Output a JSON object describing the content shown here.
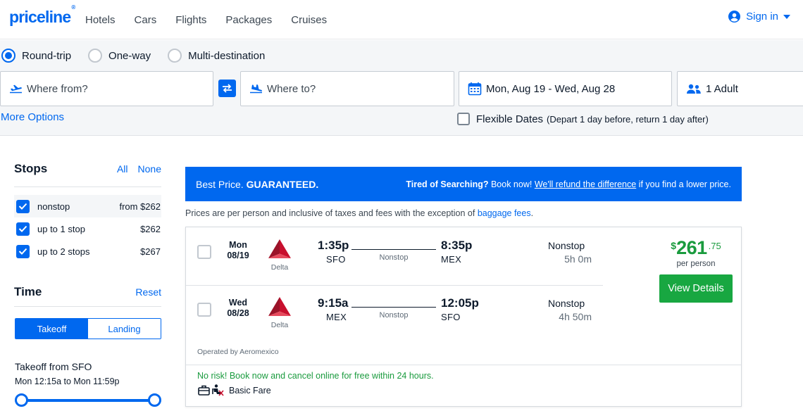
{
  "header": {
    "logo": "priceline",
    "logo_mark": "®",
    "nav": [
      "Hotels",
      "Cars",
      "Flights",
      "Packages",
      "Cruises"
    ],
    "sign_in": "Sign in"
  },
  "search": {
    "trip_types": [
      {
        "label": "Round-trip",
        "selected": true
      },
      {
        "label": "One-way",
        "selected": false
      },
      {
        "label": "Multi-destination",
        "selected": false
      }
    ],
    "from_placeholder": "Where from?",
    "to_placeholder": "Where to?",
    "dates": "Mon, Aug 19 - Wed, Aug 28",
    "passengers": "1 Adult",
    "more_options": "More Options",
    "flexible_label": "Flexible Dates",
    "flexible_note": "(Depart 1 day before, return 1 day after)"
  },
  "filters": {
    "stops_title": "Stops",
    "all": "All",
    "none": "None",
    "stops": [
      {
        "label": "nonstop",
        "price": "from $262",
        "checked": true
      },
      {
        "label": "up to 1 stop",
        "price": "$262",
        "checked": true
      },
      {
        "label": "up to 2 stops",
        "price": "$267",
        "checked": true
      }
    ],
    "time_title": "Time",
    "reset": "Reset",
    "takeoff_tab": "Takeoff",
    "landing_tab": "Landing",
    "takeoff_from": "Takeoff from SFO",
    "takeoff_range": "Mon 12:15a to Mon 11:59p"
  },
  "banner": {
    "best": "Best Price.",
    "guaranteed": "GUARANTEED.",
    "tired": "Tired of Searching?",
    "book_now": " Book now! ",
    "refund_link": "We'll refund the difference",
    "lower": " if you find a lower price."
  },
  "disclaimer": {
    "text": "Prices are per person and inclusive of taxes and fees with the exception of ",
    "link": "baggage fees",
    "end": "."
  },
  "result": {
    "legs": [
      {
        "day": "Mon",
        "date": "08/19",
        "airline": "Delta",
        "dep_time": "1:35p",
        "dep_code": "SFO",
        "arr_time": "8:35p",
        "arr_code": "MEX",
        "route": "Nonstop",
        "stops": "Nonstop",
        "duration": "5h 0m"
      },
      {
        "day": "Wed",
        "date": "08/28",
        "airline": "Delta",
        "dep_time": "9:15a",
        "dep_code": "MEX",
        "arr_time": "12:05p",
        "arr_code": "SFO",
        "route": "Nonstop",
        "stops": "Nonstop",
        "duration": "4h 50m"
      }
    ],
    "operated_by": "Operated by Aeromexico",
    "price_currency": "$",
    "price_whole": "261",
    "price_cents": ".75",
    "per_person": "per person",
    "view_details": "View Details",
    "no_risk": "No risk! Book now and cancel online for free within 24 hours.",
    "fare_type": "Basic Fare"
  },
  "colors": {
    "brand_blue": "#0068ef",
    "price_green": "#1a9b3e",
    "button_green": "#18a741",
    "delta_red": "#c8102e"
  }
}
